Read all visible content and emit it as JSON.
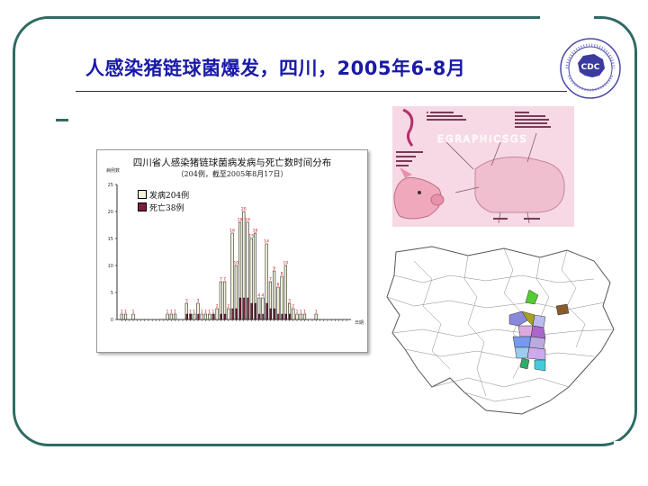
{
  "slide": {
    "title": "人感染猪链球菌爆发，四川，2005年6-8月"
  },
  "logo": {
    "name": "cdc-logo",
    "text": "CDC"
  },
  "pig_panel": {
    "watermark": "EGRAPHICSGS"
  },
  "chart_data": {
    "type": "bar",
    "title": "四川省人感染猪链球菌病发病与死亡数时间分布",
    "subtitle": "（204例，截至2005年8月17日）",
    "ylabel": "病例数",
    "xlabel": "日期",
    "ylim": [
      0,
      25
    ],
    "yticks": [
      0,
      5,
      10,
      15,
      20,
      25
    ],
    "series": [
      {
        "name": "发病204例",
        "color": "#f4f4da",
        "values": [
          1,
          1,
          0,
          1,
          0,
          0,
          0,
          0,
          0,
          0,
          0,
          0,
          1,
          1,
          1,
          0,
          0,
          3,
          1,
          1,
          3,
          1,
          1,
          1,
          1,
          2,
          7,
          7,
          2,
          16,
          10,
          18,
          20,
          18,
          15,
          16,
          4,
          4,
          14,
          7,
          9,
          6,
          8,
          10,
          3,
          2,
          1,
          1,
          1,
          0,
          0,
          1,
          0,
          0,
          0,
          0,
          0,
          0,
          0,
          0
        ]
      },
      {
        "name": "死亡38例",
        "color": "#7a1f3c",
        "values": [
          0,
          0,
          0,
          0,
          0,
          0,
          0,
          0,
          0,
          0,
          0,
          0,
          0,
          0,
          0,
          0,
          0,
          1,
          1,
          0,
          1,
          0,
          0,
          0,
          1,
          0,
          1,
          1,
          0,
          2,
          2,
          4,
          4,
          4,
          3,
          3,
          1,
          1,
          3,
          2,
          2,
          1,
          1,
          1,
          1,
          0,
          0,
          0,
          0,
          0,
          0,
          0,
          0,
          0,
          0,
          0,
          0,
          0,
          0,
          0
        ]
      }
    ]
  }
}
